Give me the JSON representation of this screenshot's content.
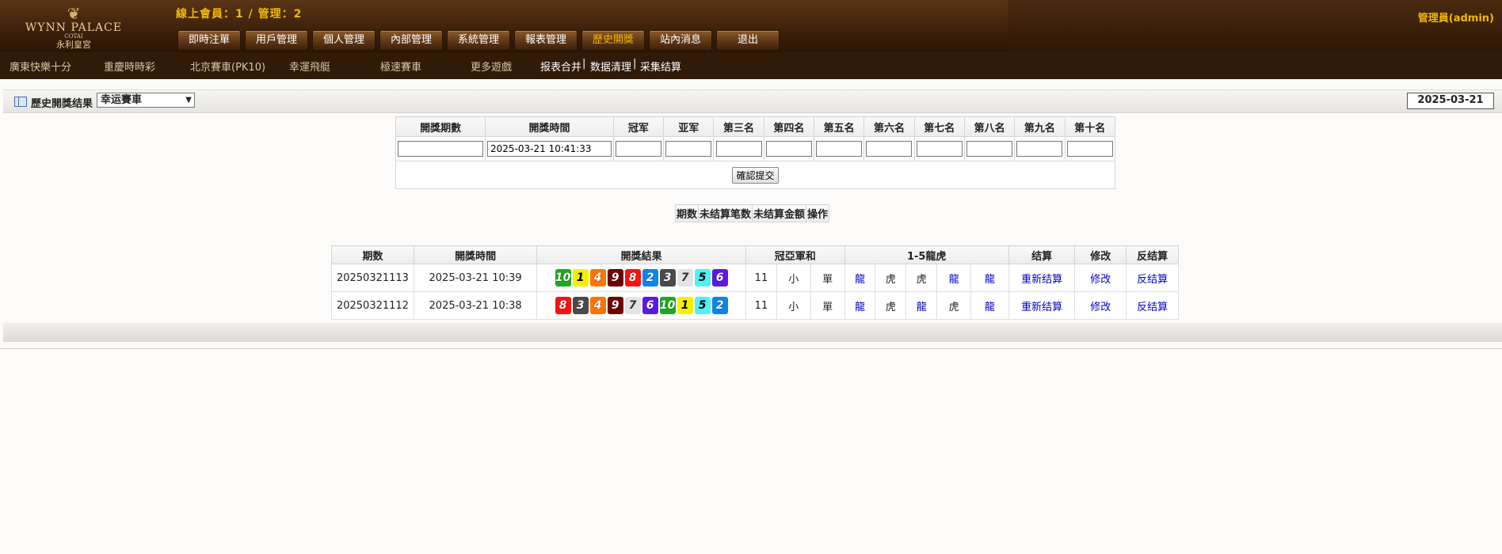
{
  "header": {
    "logo": {
      "name": "WYNN PALACE",
      "tagline": "COTAI",
      "chinese": "永利皇宮"
    },
    "online_text": "線上會員：1 / 管理：2",
    "admin_text": "管理員(admin)",
    "nav": [
      {
        "label": "即時注單"
      },
      {
        "label": "用戶管理"
      },
      {
        "label": "個人管理"
      },
      {
        "label": "內部管理"
      },
      {
        "label": "系統管理"
      },
      {
        "label": "報表管理"
      },
      {
        "label": "歷史開獎",
        "active": true
      },
      {
        "label": "站內消息"
      },
      {
        "label": "退出"
      }
    ]
  },
  "subnav": {
    "games": [
      "廣東快樂十分",
      "重慶時時彩",
      "北京賽車(PK10)",
      "幸運飛艇",
      "極速賽車",
      "更多遊戲"
    ],
    "tools": [
      "报表合并",
      "数据清理",
      "采集结算"
    ],
    "separator": "|"
  },
  "titlebar": {
    "label": "歷史開獎结果",
    "selected_game": "幸运賽車",
    "date": "2025-03-21"
  },
  "entry_form": {
    "headers": [
      "開獎期數",
      "開獎時間",
      "冠军",
      "亚军",
      "第三名",
      "第四名",
      "第五名",
      "第六名",
      "第七名",
      "第八名",
      "第九名",
      "第十名"
    ],
    "values": [
      "",
      "2025-03-21 10:41:33",
      "",
      "",
      "",
      "",
      "",
      "",
      "",
      "",
      "",
      ""
    ],
    "submit_label": "確認提交"
  },
  "pending_table": {
    "headers": [
      "期数",
      "未结算笔数",
      "未结算金额",
      "操作"
    ]
  },
  "results": {
    "headers": [
      "期数",
      "開獎時間",
      "開獎結果",
      "冠亞軍和",
      "1-5龍虎",
      "结算",
      "修改",
      "反结算"
    ],
    "rows": [
      {
        "period": "20250321113",
        "time": "2025-03-21 10:39",
        "balls": [
          10,
          1,
          4,
          9,
          8,
          2,
          3,
          7,
          5,
          6
        ],
        "sum": "11",
        "size": "小",
        "parity": "單",
        "dragon_tiger": [
          "龍",
          "虎",
          "虎",
          "龍",
          "龍"
        ],
        "settle": "重新结算",
        "edit": "修改",
        "unsettle": "反结算"
      },
      {
        "period": "20250321112",
        "time": "2025-03-21 10:38",
        "balls": [
          8,
          3,
          4,
          9,
          7,
          6,
          10,
          1,
          5,
          2
        ],
        "sum": "11",
        "size": "小",
        "parity": "單",
        "dragon_tiger": [
          "龍",
          "虎",
          "龍",
          "虎",
          "龍"
        ],
        "settle": "重新结算",
        "edit": "修改",
        "unsettle": "反结算"
      }
    ]
  },
  "colors": {
    "header_brown": "#3e220c",
    "gold_text": "#f0b800",
    "link_blue": "#0000cc"
  }
}
